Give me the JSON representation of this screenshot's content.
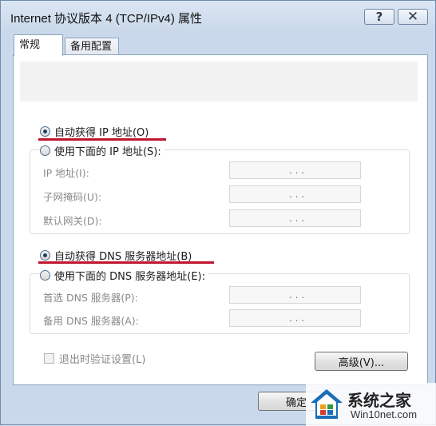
{
  "window": {
    "title": "Internet 协议版本 4 (TCP/IPv4) 属性",
    "help_glyph": "?",
    "close_glyph": "✕"
  },
  "tabs": [
    {
      "label": "常规",
      "active": true
    },
    {
      "label": "备用配置",
      "active": false
    }
  ],
  "ip_section": {
    "auto_label": "自动获得 IP 地址(O)",
    "manual_label": "使用下面的 IP 地址(S):",
    "auto_selected": true,
    "fields": [
      {
        "label": "IP 地址(I):",
        "value": ".   .   ."
      },
      {
        "label": "子网掩码(U):",
        "value": ".   .   ."
      },
      {
        "label": "默认网关(D):",
        "value": ".   .   ."
      }
    ]
  },
  "dns_section": {
    "auto_label": "自动获得 DNS 服务器地址(B)",
    "manual_label": "使用下面的 DNS 服务器地址(E):",
    "auto_selected": true,
    "fields": [
      {
        "label": "首选 DNS 服务器(P):",
        "value": ".   .   ."
      },
      {
        "label": "备用 DNS 服务器(A):",
        "value": ".   .   ."
      }
    ]
  },
  "validate_on_exit": {
    "label": "退出时验证设置(L)",
    "checked": false
  },
  "buttons": {
    "advanced": "高级(V)...",
    "ok": "确定"
  },
  "watermark": {
    "brand": "系统之家",
    "url": "Win10net.com"
  },
  "colors": {
    "highlight_underline": "#c0152e",
    "window_frame": "#c9d8ea"
  }
}
